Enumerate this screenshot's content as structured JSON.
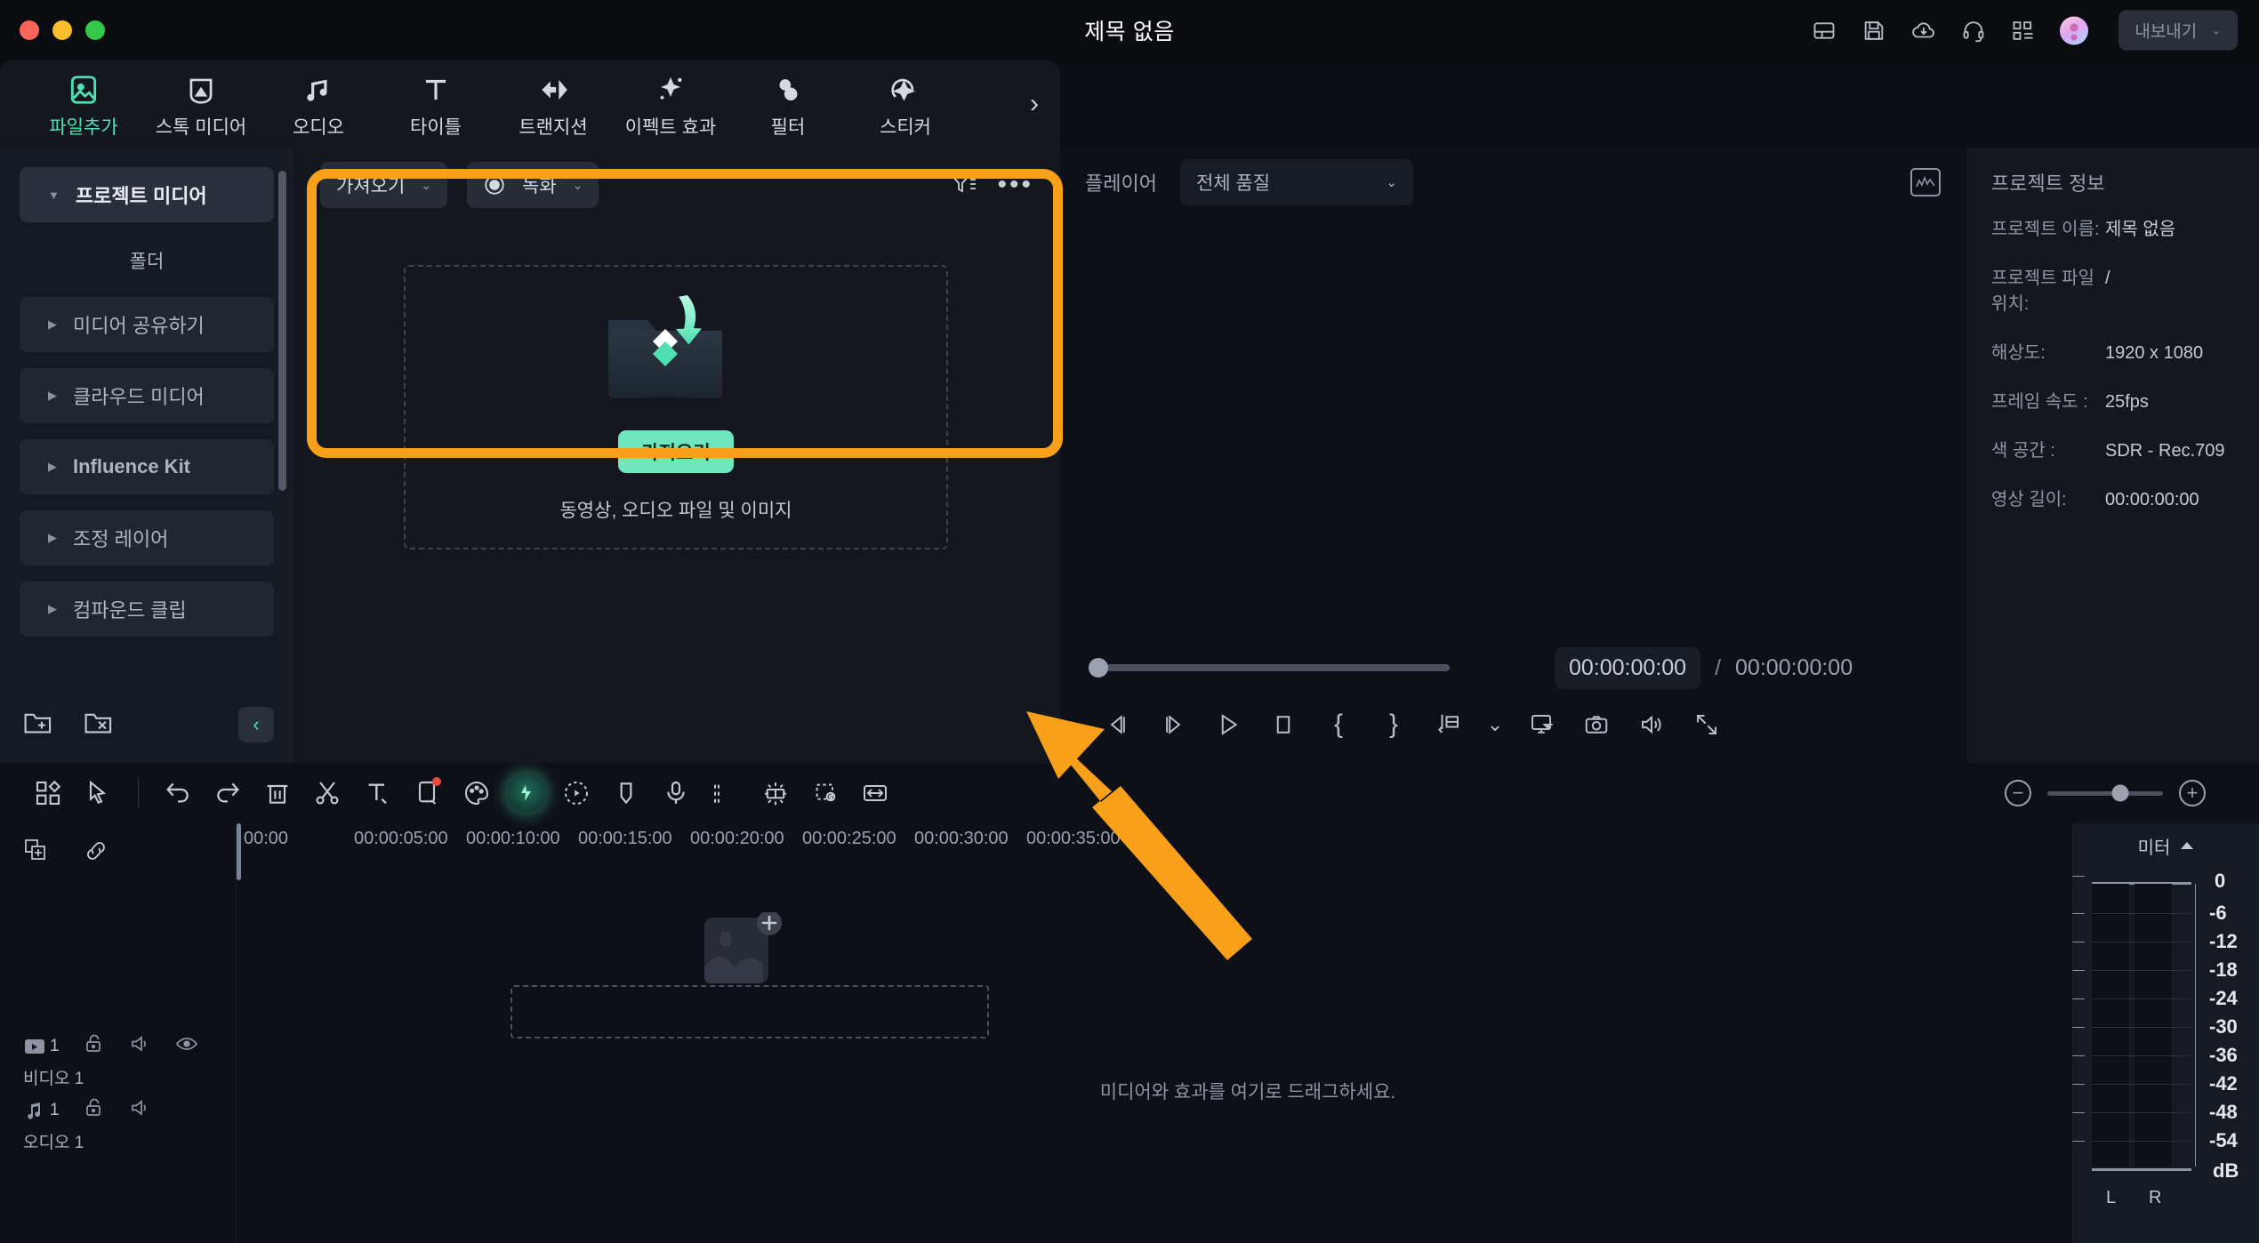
{
  "titlebar": {
    "title": "제목 없음",
    "icons": [
      "layout-panel-icon",
      "save-icon",
      "cloud-upload-icon",
      "headset-support-icon",
      "apps-grid-icon"
    ],
    "avatar": "user-avatar",
    "export_label": "내보내기",
    "export_chevron": "⌄"
  },
  "tabs": [
    {
      "label": "파일추가",
      "icon": "media-add-icon",
      "active": true
    },
    {
      "label": "스톡 미디어",
      "icon": "stock-media-icon",
      "active": false
    },
    {
      "label": "오디오",
      "icon": "music-note-icon",
      "active": false
    },
    {
      "label": "타이틀",
      "icon": "text-title-icon",
      "active": false
    },
    {
      "label": "트랜지션",
      "icon": "transition-icon",
      "active": false
    },
    {
      "label": "이펙트 효과",
      "icon": "effects-sparkle-icon",
      "active": false
    },
    {
      "label": "필터",
      "icon": "filter-circles-icon",
      "active": false
    },
    {
      "label": "스티커",
      "icon": "sticker-icon",
      "active": false
    }
  ],
  "tabs_next_chevron": "›",
  "sidebar": {
    "items": [
      {
        "label": "프로젝트 미디어",
        "state": "selected",
        "caret": "▼"
      },
      {
        "label": "폴더",
        "state": "sub",
        "caret": ""
      },
      {
        "label": "미디어 공유하기",
        "state": "hover",
        "caret": "▶"
      },
      {
        "label": "클라우드 미디어",
        "state": "hover",
        "caret": "▶"
      },
      {
        "label": "Influence Kit",
        "state": "hover",
        "caret": "▶"
      },
      {
        "label": "조정 레이어",
        "state": "hover",
        "caret": "▶"
      },
      {
        "label": "컴파운드 클립",
        "state": "hover",
        "caret": "▶"
      }
    ],
    "footer_icons": [
      "new-folder-icon",
      "delete-folder-icon"
    ],
    "collapse_icon": "chevron-left-icon"
  },
  "media": {
    "import_pill": {
      "label": "가져오기",
      "chevron": "⌄"
    },
    "record_pill": {
      "label": "녹화",
      "chevron": "⌄",
      "icon": "record-circle-icon"
    },
    "filter_icon": "filter-sort-icon",
    "more_icon": "more-dots-icon",
    "dropzone": {
      "folder_icon": "import-folder-icon",
      "button_label": "가져오기",
      "caption": "동영상, 오디오 파일 및 이미지"
    }
  },
  "player": {
    "label": "플레이어",
    "quality": {
      "value": "전체 품질",
      "chevron": "⌄"
    },
    "scope_icon": "waveform-scope-icon",
    "current_time": "00:00:00:00",
    "separator": "/",
    "total_time": "00:00:00:00",
    "transport": [
      {
        "name": "prev-frame-icon"
      },
      {
        "name": "next-frame-icon"
      },
      {
        "name": "play-icon"
      },
      {
        "name": "stop-icon"
      },
      {
        "name": "mark-in-icon",
        "glyph": "{"
      },
      {
        "name": "mark-out-icon",
        "glyph": "}"
      },
      {
        "name": "split-marker-icon"
      },
      {
        "name": "dropdown-chevron-icon",
        "glyph": "⌄"
      },
      {
        "name": "screen-cast-icon"
      },
      {
        "name": "snapshot-camera-icon"
      },
      {
        "name": "volume-icon"
      },
      {
        "name": "fullscreen-icon"
      }
    ]
  },
  "project_info": {
    "title": "프로젝트 정보",
    "rows": [
      {
        "key": "프로젝트 이름:",
        "value": "제목 없음"
      },
      {
        "key": "프로젝트 파일 위치:",
        "value": "/"
      },
      {
        "key": "해상도:",
        "value": "1920 x 1080"
      },
      {
        "key": "프레임 속도 :",
        "value": "25fps"
      },
      {
        "key": "색 공간 :",
        "value": "SDR - Rec.709"
      },
      {
        "key": "영상 길이:",
        "value": "00:00:00:00"
      }
    ]
  },
  "timeline": {
    "toolbar_icons": [
      "template-grid-icon",
      "selection-tool-icon",
      "divider",
      "undo-icon",
      "redo-icon",
      "delete-icon",
      "split-scissors-icon",
      "add-text-icon",
      "crop-icon",
      "color-palette-icon",
      "ai-tools-icon",
      "motion-tracking-icon",
      "marker-icon",
      "voiceover-mic-icon",
      "audio-detach-icon",
      "green-screen-icon",
      "background-remove-icon",
      "fit-to-screen-icon"
    ],
    "zoom_out_glyph": "−",
    "zoom_in_glyph": "+",
    "head_tools": [
      "add-track-icon",
      "link-clips-icon"
    ],
    "ruler_labels": [
      "00:00",
      "00:00:05:00",
      "00:00:10:00",
      "00:00:15:00",
      "00:00:20:00",
      "00:00:25:00",
      "00:00:30:00",
      "00:00:35:00"
    ],
    "tracks": [
      {
        "name": "비디오 1",
        "number": "1",
        "icons": [
          "video-track-icon",
          "lock-icon",
          "mute-icon",
          "eye-visibility-icon"
        ]
      },
      {
        "name": "오디오 1",
        "number": "1",
        "icons": [
          "audio-track-icon",
          "lock-icon",
          "mute-icon"
        ]
      }
    ],
    "drag_hint": "미디어와 효과를 여기로 드래그하세요.",
    "placeholder_icon": "add-media-placeholder-icon"
  },
  "meter": {
    "title": "미터",
    "collapse_glyph": "▲",
    "scale": [
      "0",
      "-6",
      "-12",
      "-18",
      "-24",
      "-30",
      "-36",
      "-42",
      "-48",
      "-54",
      "dB"
    ],
    "channels": [
      "L",
      "R"
    ]
  },
  "annotation": {
    "highlight_color": "#f9a01b",
    "arrow_color": "#f9a01b"
  }
}
